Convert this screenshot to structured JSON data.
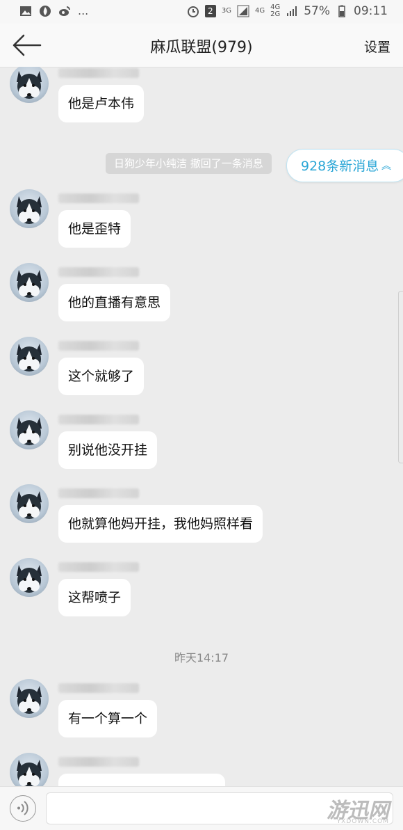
{
  "status_bar": {
    "left_dots": "...",
    "badge": "2",
    "net1": "3G",
    "net2": "4G",
    "net3": "4G",
    "net4": "2G",
    "battery": "57%",
    "time": "09:11"
  },
  "header": {
    "title": "麻瓜联盟(979)",
    "settings_label": "设置"
  },
  "new_messages": {
    "label": "928条新消息",
    "chevron": "︽"
  },
  "notice": "日狗少年小纯洁 撤回了一条消息",
  "timestamp": "昨天14:17",
  "messages": [
    {
      "text": "他是卢本伟"
    },
    {
      "text": "他是歪特"
    },
    {
      "text": "他的直播有意思"
    },
    {
      "text": "这个就够了"
    },
    {
      "text": "别说他没开挂"
    },
    {
      "text": "他就算他妈开挂，我他妈照样看"
    },
    {
      "text": "这帮喷子"
    },
    {
      "text": "有一个算一个"
    },
    {
      "text": ""
    }
  ],
  "watermark": {
    "text": "游迅网",
    "sub": "YXDOWN.COM"
  }
}
